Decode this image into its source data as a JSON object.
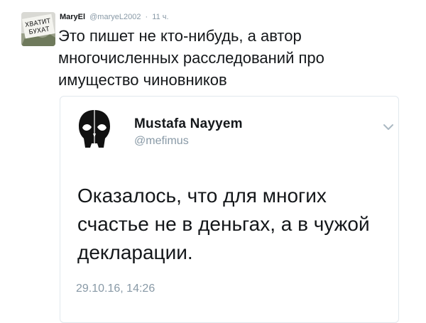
{
  "tweet": {
    "author_name": "MaryEl",
    "author_handle": "@maryeL2002",
    "separator": "·",
    "time_ago": "11 ч.",
    "text": "Это пишет не кто-нибудь, а автор\nмногочисленных расследований про\nимущество чиновников",
    "avatar": {
      "icon": "protest-sign-photo",
      "sign_text": [
        "ХВАТИТ",
        "БУХАТ"
      ]
    }
  },
  "quoted_tweet": {
    "author_name": "Mustafa Nayyem",
    "author_handle": "@mefimus",
    "avatar_icon": "skull-silhouette-icon",
    "menu_icon": "chevron-down-icon",
    "text": "Оказалось, что для многих\nсчастье не в деньгах, а в чужой\nдекларации.",
    "date": "29.10.16, 14:26"
  },
  "colors": {
    "text": "#14171a",
    "secondary": "#8899a6",
    "border": "#e1e8ed"
  }
}
